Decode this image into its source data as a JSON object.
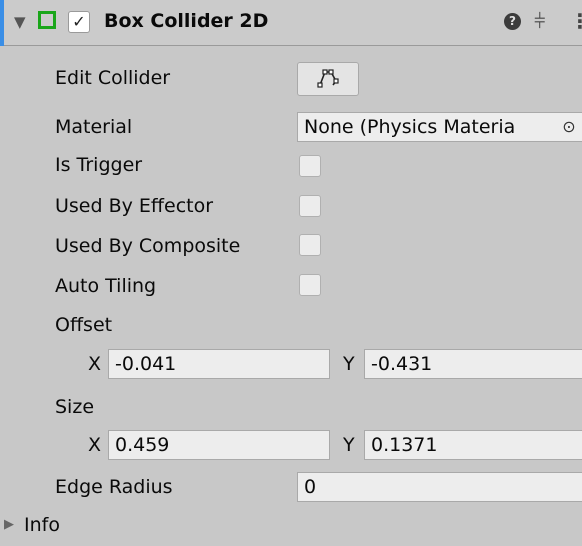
{
  "header": {
    "title": "Box Collider 2D",
    "enabled": true,
    "accent_color": "#3a8ee6",
    "component_icon_color": "#1aa61a",
    "icons": [
      "collapse-caret-icon",
      "box-collider-icon",
      "help-icon",
      "presets-icon",
      "more-options-icon"
    ]
  },
  "fields": {
    "edit_collider_label": "Edit Collider",
    "material_label": "Material",
    "material_value": "None (Physics Materia",
    "is_trigger_label": "Is Trigger",
    "used_by_effector_label": "Used By Effector",
    "used_by_composite_label": "Used By Composite",
    "auto_tiling_label": "Auto Tiling",
    "offset_label": "Offset",
    "offset": {
      "x_label": "X",
      "x": "-0.041",
      "y_label": "Y",
      "y": "-0.431"
    },
    "size_label": "Size",
    "size": {
      "x_label": "X",
      "x": "0.459",
      "y_label": "Y",
      "y": "0.1371"
    },
    "edge_radius_label": "Edge Radius",
    "edge_radius": "0",
    "info_label": "Info"
  },
  "checkboxes": {
    "is_trigger": false,
    "used_by_effector": false,
    "used_by_composite": false,
    "auto_tiling": false
  }
}
